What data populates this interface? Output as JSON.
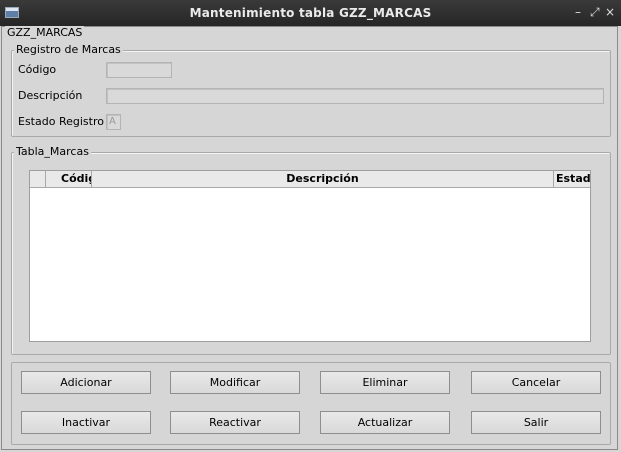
{
  "window": {
    "title": "Mantenimiento tabla GZZ_MARCAS",
    "controls": [
      "–",
      "⤢",
      "×"
    ]
  },
  "frame_label": "GZZ_MARCAS",
  "registro": {
    "legend": "Registro de Marcas",
    "codigo_label": "Código",
    "codigo_value": "",
    "descripcion_label": "Descripción",
    "descripcion_value": "",
    "estado_label": "Estado Registro",
    "estado_value": "A"
  },
  "tabla": {
    "legend": "Tabla_Marcas",
    "columns": [
      "Código",
      "Descripción",
      "Estad"
    ],
    "rows": []
  },
  "buttons": {
    "adicionar": "Adicionar",
    "modificar": "Modificar",
    "eliminar": "Eliminar",
    "cancelar": "Cancelar",
    "inactivar": "Inactivar",
    "reactivar": "Reactivar",
    "actualizar": "Actualizar",
    "salir": "Salir"
  }
}
